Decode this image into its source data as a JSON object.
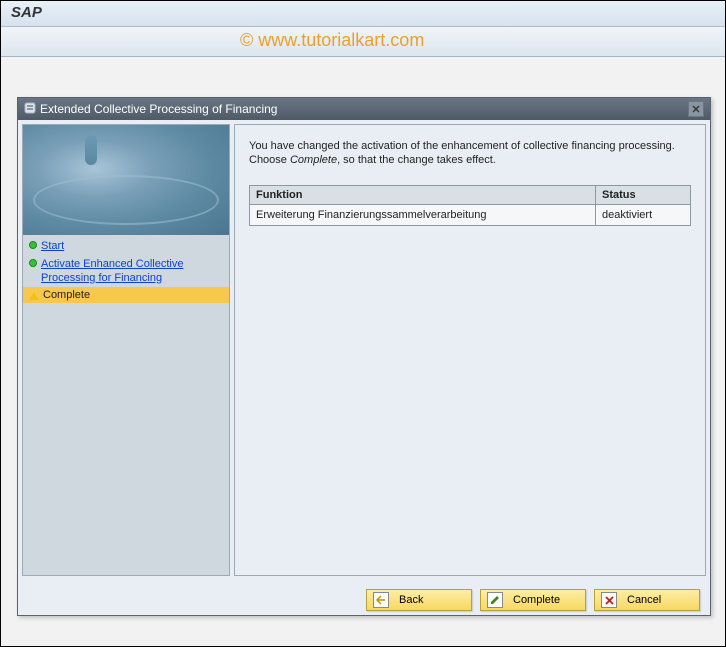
{
  "app": {
    "title": "SAP"
  },
  "watermark": {
    "text": "© www.tutorialkart.com"
  },
  "dialog": {
    "title": "Extended Collective Processing of Financing",
    "sidebar": {
      "items": [
        {
          "label": "Start",
          "state": "done"
        },
        {
          "label": "Activate Enhanced Collective Processing for Financing",
          "state": "done"
        },
        {
          "label": "Complete",
          "state": "current"
        }
      ]
    },
    "content": {
      "intro_prefix": "You have changed the activation of the enhancement of collective financing processing. Choose ",
      "intro_action": "Complete",
      "intro_suffix": ", so that the change takes effect.",
      "table": {
        "headers": {
          "col1": "Funktion",
          "col2": "Status"
        },
        "rows": [
          {
            "funktion": "Erweiterung Finanzierungssammelverarbeitung",
            "status": "deaktiviert"
          }
        ]
      }
    },
    "buttons": {
      "back": "Back",
      "complete": "Complete",
      "cancel": "Cancel"
    }
  }
}
